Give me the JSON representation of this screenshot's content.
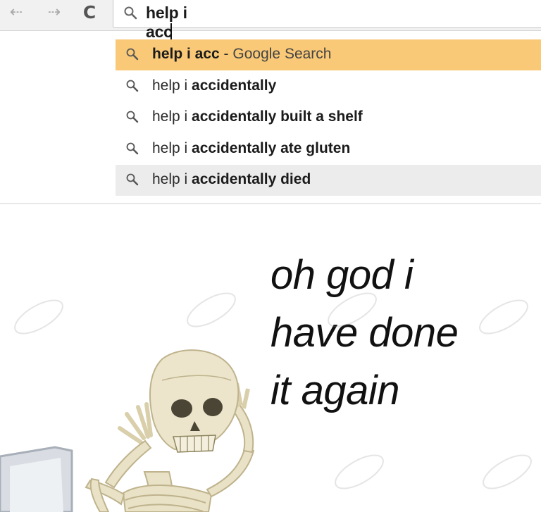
{
  "toolbar": {
    "back_icon": "back-arrow-icon",
    "forward_icon": "forward-arrow-icon",
    "reload_icon": "reload-icon",
    "omnibox_value": "help i acc"
  },
  "suggestions": [
    {
      "query": "help i acc",
      "bold": "help i acc",
      "rest": "",
      "suffix": " - ",
      "engine": "Google Search",
      "state": "selected"
    },
    {
      "query": "help i accidentally",
      "bold": "help i ",
      "rest": "accidentally",
      "state": "normal"
    },
    {
      "query": "help i accidentally built a shelf",
      "bold": "help i ",
      "rest": "accidentally built a shelf",
      "state": "normal"
    },
    {
      "query": "help i accidentally ate gluten",
      "bold": "help i ",
      "rest": "accidentally ate gluten",
      "state": "normal"
    },
    {
      "query": "help i accidentally died",
      "bold": "help i ",
      "rest": "accidentally died",
      "state": "hover"
    }
  ],
  "caption": {
    "line1": "oh god i",
    "line2": "have done",
    "line3": "it again"
  },
  "colors": {
    "selected_row": "#f9c978",
    "hover_row": "#ececec",
    "bone": "#e9e2c6",
    "bone_shadow": "#bfb38d"
  }
}
